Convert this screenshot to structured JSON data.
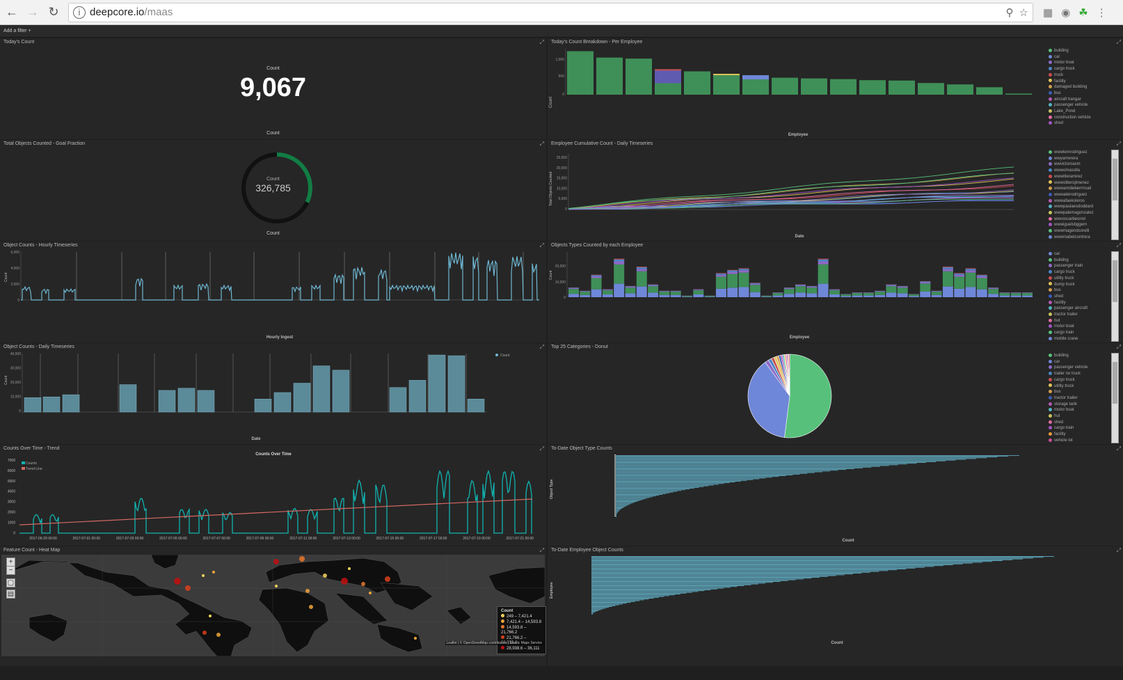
{
  "browser": {
    "url_host": "deepcore.io",
    "url_path": "/maas"
  },
  "filter": {
    "label": "Add a filter",
    "plus": "+"
  },
  "panels": {
    "todays_count": {
      "title": "Today's Count",
      "label": "Count",
      "value": "9,067",
      "footer": "Count"
    },
    "breakdown": {
      "title": "Today's Count Breakdown - Per Employee",
      "ylabel": "Count",
      "xlabel": "Employee",
      "yticks": [
        "1,000",
        "500",
        "0"
      ],
      "legend": [
        "building",
        "car",
        "motor boat",
        "cargo truck",
        "truck",
        "facility",
        "damaged building",
        "bus",
        "aircraft hangar",
        "passenger vehicle",
        "Lake_Pond",
        "construction vehicle",
        "shed"
      ],
      "colors": [
        "#57c17b",
        "#6f87d8",
        "#8d6ac5",
        "#4a86c6",
        "#c84e53",
        "#e0c35a",
        "#d19c4d",
        "#3b5bb5",
        "#b65ab5",
        "#52b3c4",
        "#c7c55e",
        "#e26ba0",
        "#a154c5"
      ]
    },
    "goal": {
      "title": "Total Objects Counted - Goal Fraction",
      "label": "Count",
      "value": "326,785",
      "footer": "Count",
      "fraction": 0.32
    },
    "cumulative": {
      "title": "Employee Cumulative Count - Daily Timeseries",
      "ylabel": "Total Objects Counted",
      "xlabel": "Date",
      "yticks": [
        "25,000",
        "20,000",
        "15,000",
        "10,000",
        "5,000",
        "0"
      ],
      "legend": [
        "wwwlemrodriguez",
        "wwyarrierera",
        "wwvictoroasm",
        "wwwomasolla",
        "wwwitleramirez",
        "wwwolbersjimenez",
        "wwwamdieberrrnuel",
        "wwwaleirodriguez",
        "wwwafaekoleros",
        "wwwpaulaesdoddard",
        "wwwpalemagonzalez",
        "wwvoscarbeorrel",
        "wwwiguelsbggern",
        "wwwmagendsorelli",
        "wwwmabetcontrera"
      ],
      "colors": [
        "#57c17b",
        "#6f87d8",
        "#8d6ac5",
        "#4a86c6",
        "#c84e53",
        "#e0c35a",
        "#d19c4d",
        "#3b5bb5",
        "#b65ab5",
        "#52b3c4",
        "#c7c55e",
        "#e26ba0",
        "#a154c5",
        "#57c17b",
        "#6f87d8"
      ]
    },
    "hourly": {
      "title": "Object Counts - Hourly Timeseries",
      "ylabel": "Count",
      "xlabel": "Hourly Ingest",
      "yticks": [
        "6,000",
        "4,000",
        "2,000",
        "0"
      ]
    },
    "types_by_employee": {
      "title": "Objects Types Counted by each Employee",
      "ylabel": "Count",
      "xlabel": "Employee",
      "yticks": [
        "20,000",
        "10,000",
        "0"
      ],
      "legend": [
        "car",
        "building",
        "passenger train",
        "cargo truck",
        "utility truck",
        "dump truck",
        "bus",
        "shed",
        "facility",
        "passenger aircraft",
        "tractor trailer",
        "hut",
        "motor boat",
        "cargo train",
        "mobile crane"
      ],
      "colors": [
        "#6f87d8",
        "#57c17b",
        "#8d6ac5",
        "#4a86c6",
        "#c84e53",
        "#e0c35a",
        "#d19c4d",
        "#3b5bb5",
        "#b65ab5",
        "#52b3c4",
        "#c7c55e",
        "#e26ba0",
        "#a154c5",
        "#57c17b",
        "#6f87d8"
      ]
    },
    "daily": {
      "title": "Object Counts - Daily Timeseries",
      "ylabel": "Count",
      "xlabel": "Date",
      "legend": "Count",
      "yticks": [
        "40,000",
        "30,000",
        "20,000",
        "10,000",
        "0"
      ]
    },
    "donut": {
      "title": "Top 25 Categories - Donut",
      "legend": [
        "building",
        "car",
        "passenger vehicle",
        "trailer no truck",
        "cargo truck",
        "utility truck",
        "bus",
        "tractor trailer",
        "storage tank",
        "motor boat",
        "hut",
        "shed",
        "cargo train",
        "facility",
        "vehicle lot"
      ],
      "colors": [
        "#57c17b",
        "#6f87d8",
        "#8d6ac5",
        "#4a86c6",
        "#c84e53",
        "#e0c35a",
        "#d19c4d",
        "#3b5bb5",
        "#b65ab5",
        "#52b3c4",
        "#c7c55e",
        "#e26ba0",
        "#a154c5",
        "#e89a3c",
        "#c84e9a"
      ]
    },
    "trend": {
      "title": "Counts Over Time - Trend",
      "chart_title": "Counts Over Time",
      "legend": [
        "Counts",
        "Trend Line"
      ],
      "yticks": [
        "7000",
        "6000",
        "5000",
        "4000",
        "3000",
        "2000",
        "1000",
        "0"
      ],
      "xticks": [
        "2017-06-29 00:00",
        "2017-07-01 00:00",
        "2017-07-03 00:00",
        "2017-07-05 00:00",
        "2017-07-07 00:00",
        "2017-07-09 00:00",
        "2017-07-11 00:00",
        "2017-07-13 00:00",
        "2017-07-15 00:00",
        "2017-07-17 00:00",
        "2017-07-19 00:00",
        "2017-07-21 00:00"
      ]
    },
    "todate_types": {
      "title": "To-Date Object Type Counts",
      "ylabel": "Object Type",
      "xlabel": "Count"
    },
    "heatmap": {
      "title": "Feature Count - Heat Map",
      "legend_title": "Count",
      "legend": [
        "249 – 7,421.4",
        "7,421.4 – 14,593.8",
        "14,593.8 – 21,766.2",
        "21,766.2 – 28,938.6",
        "28,938.6 – 36,111"
      ],
      "legend_colors": [
        "#f3d35a",
        "#f0a63a",
        "#e8772a",
        "#d8401c",
        "#c21010"
      ],
      "attribution": "Leaflet | © OpenStreetMap contributors | Elastic Maps Service"
    },
    "todate_employee": {
      "title": "To-Date Employee Object Counts",
      "ylabel": "Employee",
      "xlabel": "Count"
    }
  }
}
